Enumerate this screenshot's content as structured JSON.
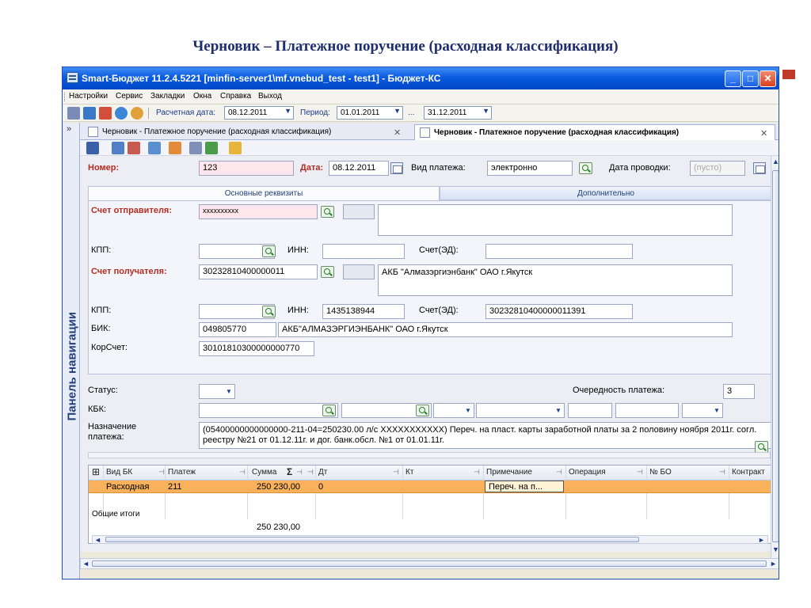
{
  "slide": {
    "title": "Черновик – Платежное поручение (расходная классификация)"
  },
  "window": {
    "title": "Smart-Бюджет 11.2.4.5221 [minfin-server1\\mf.vnebud_test - test1] - Бюджет-КС",
    "minimize": "_",
    "maximize": "□",
    "close": "✕"
  },
  "menu": [
    "Настройки",
    "Сервис",
    "Закладки",
    "Окна",
    "Справка",
    "Выход"
  ],
  "toolbar": {
    "calc_date_label": "Расчетная дата:",
    "calc_date_value": "08.12.2011",
    "period_label": "Период:",
    "period_from": "01.01.2011",
    "period_sep": "...",
    "period_to": "31.12.2011"
  },
  "nav_panel": {
    "label": "Панель навигации",
    "chevron": "»"
  },
  "doc_tabs": [
    {
      "label": "Черновик - Платежное поручение (расходная классификация)",
      "close": "✕"
    },
    {
      "label": "Черновик - Платежное поручение (расходная классификация)",
      "close": "✕"
    }
  ],
  "form": {
    "number_label": "Номер:",
    "number_value": "123",
    "date_label": "Дата:",
    "date_value": "08.12.2011",
    "payment_type_label": "Вид платежа:",
    "payment_type_value": "электронно",
    "posting_date_label": "Дата проводки:",
    "posting_date_value": "(пусто)",
    "tabs": [
      "Основные реквизиты",
      "Дополнительно"
    ],
    "sender_account_label": "Счет отправителя:",
    "sender_account_value": "хххххххххх",
    "kpp_label": "КПП:",
    "inn_label": "ИНН:",
    "account_ed_label": "Счет(ЭД):",
    "recipient_account_label": "Счет получателя:",
    "recipient_account_value": "30232810400000011",
    "recipient_name": "АКБ \"Алмазэргиэнбанк\" ОАО г.Якутск",
    "recipient_kpp_label": "КПП:",
    "recipient_inn_label": "ИНН:",
    "recipient_inn_value": "1435138944",
    "recipient_account_ed_label": "Счет(ЭД):",
    "recipient_account_ed_value": "30232810400000011391",
    "bik_label": "БИК:",
    "bik_value": "049805770",
    "bank_name": "АКБ\"АЛМАЗЭРГИЭНБАНК\" ОАО г.Якутск",
    "kor_label": "КорСчет:",
    "kor_value": "30101810300000000770",
    "status_label": "Статус:",
    "queue_label": "Очередность платежа:",
    "queue_value": "3",
    "kbk_label": "КБК:",
    "purpose_label_1": "Назначение",
    "purpose_label_2": "платежа:",
    "purpose_value": "(05400000000000000-211-04=250230.00 л/с ХХХХХХХХХХХ) Переч. на пласт. карты заработной платы за 2 половину ноября 2011г. согл. реестру №21 от 01.12.11г. и дог. банк.обсл. №1 от 01.01.11г."
  },
  "grid": {
    "columns": [
      "Вид БК",
      "Платеж",
      "Сумма",
      "Дт",
      "Кт",
      "Примечание",
      "Операция",
      "№ БО",
      "Контракт"
    ],
    "sum_symbol": "Σ",
    "rows": [
      {
        "vid_bk": "Расходная",
        "platezh": "211",
        "summa": "250 230,00",
        "dt": "0",
        "primechanie": "Переч. на п..."
      }
    ],
    "totals_label": "Общие итоги",
    "totals_sum": "250 230,00"
  }
}
